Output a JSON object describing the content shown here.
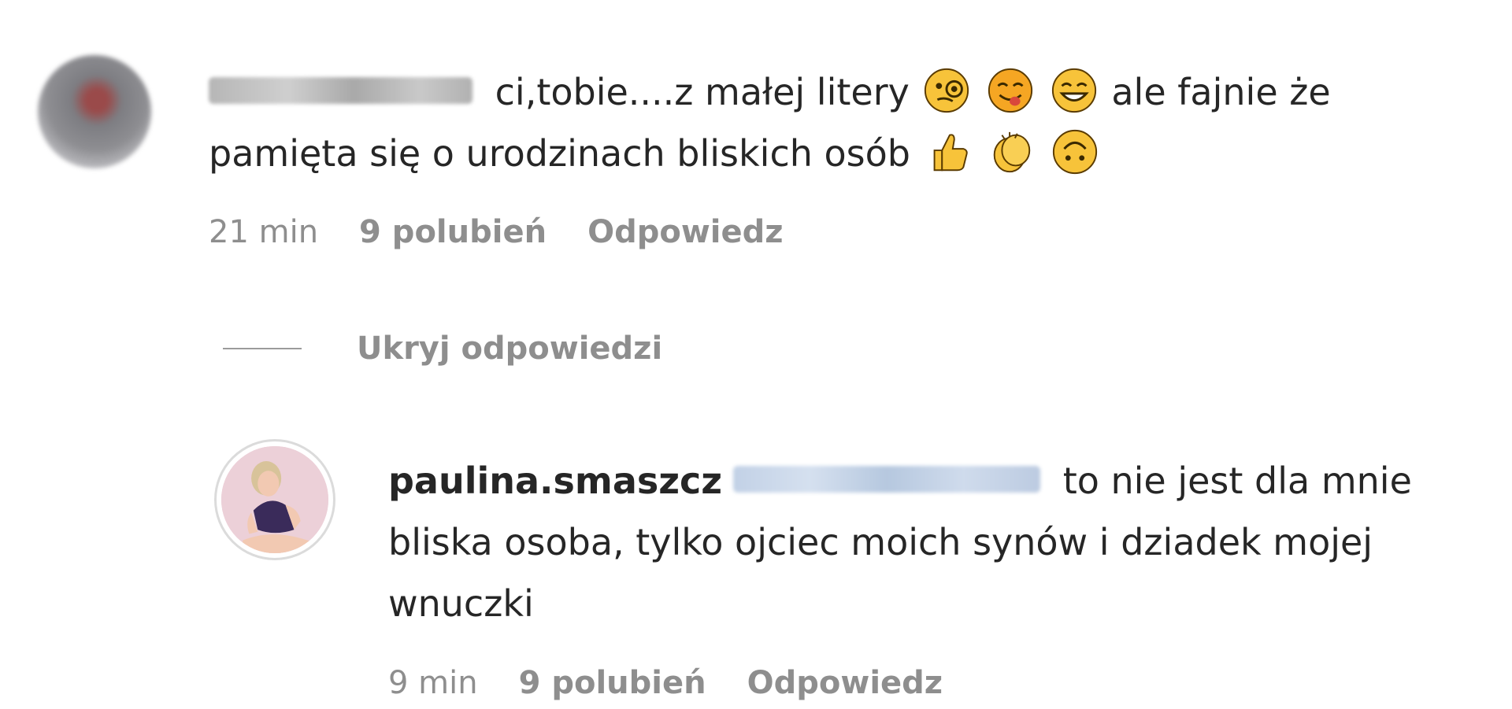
{
  "comment": {
    "username_redacted": true,
    "text_part1": "ci,tobie....z małej litery",
    "emojis_line1": [
      "monocle-face-emoji",
      "yum-face-emoji",
      "grinning-face-emoji"
    ],
    "text_part2": "ale fajnie że pamięta się o urodzinach bliskich osób",
    "emojis_line2": [
      "thumbs-up-emoji",
      "clapping-hands-emoji",
      "upside-down-face-emoji"
    ],
    "time": "21 min",
    "likes": "9 polubień",
    "reply_label": "Odpowiedz"
  },
  "replies_toggle": {
    "label": "Ukryj odpowiedzi"
  },
  "reply": {
    "username": "paulina.smaszcz",
    "mention_redacted": true,
    "text": "to nie jest dla mnie bliska osoba, tylko ojciec moich synów i dziadek mojej wnuczki",
    "time": "9 min",
    "likes": "9 polubień",
    "reply_label": "Odpowiedz"
  },
  "colors": {
    "text": "#262626",
    "secondary": "#8e8e8e",
    "emoji_yellow": "#f7c33a",
    "mention_blur": "#c2d1e6"
  }
}
